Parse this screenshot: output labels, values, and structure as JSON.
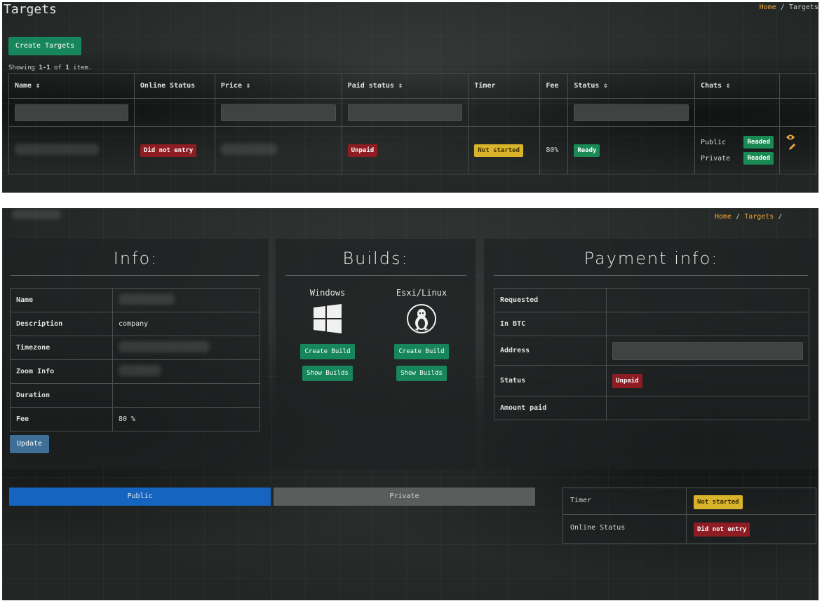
{
  "list_page": {
    "title": "Targets",
    "breadcrumb": {
      "home": "Home",
      "sep": "/",
      "current": "Targets"
    },
    "create_button": "Create Targets",
    "summary": {
      "prefix": "Showing ",
      "range": "1-1",
      "middle": " of ",
      "total": "1",
      "suffix": " item."
    },
    "columns": [
      {
        "label": "Name",
        "sort": "⇕"
      },
      {
        "label": "Online Status",
        "sort": ""
      },
      {
        "label": "Price",
        "sort": "⇕"
      },
      {
        "label": "Paid status",
        "sort": "⇕"
      },
      {
        "label": "Timer",
        "sort": ""
      },
      {
        "label": "Fee",
        "sort": ""
      },
      {
        "label": "Status",
        "sort": "⇕"
      },
      {
        "label": "Chats",
        "sort": "⇕"
      }
    ],
    "row": {
      "online_status": "Did not entry",
      "paid_status": "Unpaid",
      "timer": "Not started",
      "fee": "80%",
      "status": "Ready",
      "chats": [
        {
          "label": "Public",
          "state": "Readed"
        },
        {
          "label": "Private",
          "state": "Readed"
        }
      ]
    },
    "icons": {
      "view": "eye-icon",
      "edit": "pencil-icon"
    }
  },
  "detail_page": {
    "breadcrumb": {
      "home": "Home",
      "sep": "/",
      "targets": "Targets",
      "trail": "/"
    },
    "info": {
      "title": "Info:",
      "rows": [
        {
          "label": "Name",
          "value": ""
        },
        {
          "label": "Description",
          "value": "company"
        },
        {
          "label": "Timezone",
          "value": ""
        },
        {
          "label": "Zoom Info",
          "value": ""
        },
        {
          "label": "Duration",
          "value": ""
        },
        {
          "label": "Fee",
          "value": "80 %"
        }
      ],
      "update_button": "Update"
    },
    "builds": {
      "title": "Builds:",
      "windows": {
        "label": "Windows",
        "icon": "windows-icon",
        "create": "Create Build",
        "show": "Show Builds"
      },
      "linux": {
        "label": "Esxi/Linux",
        "icon": "linux-icon",
        "create": "Create Build",
        "show": "Show Builds"
      }
    },
    "payment": {
      "title": "Payment info:",
      "rows": [
        {
          "label": "Requested"
        },
        {
          "label": "In BTC"
        },
        {
          "label": "Address"
        },
        {
          "label": "Status",
          "value": "Unpaid"
        },
        {
          "label": "Amount paid"
        }
      ]
    },
    "tabs": {
      "public": "Public",
      "private": "Private"
    },
    "status_box": {
      "timer_label": "Timer",
      "timer_value": "Not started",
      "online_label": "Online Status",
      "online_value": "Did not entry"
    },
    "colors": {
      "accent_link": "#f0a73a",
      "primary": "#1565c0",
      "success": "#17865c",
      "danger": "#8e1d23",
      "warning": "#d9b42a"
    }
  }
}
